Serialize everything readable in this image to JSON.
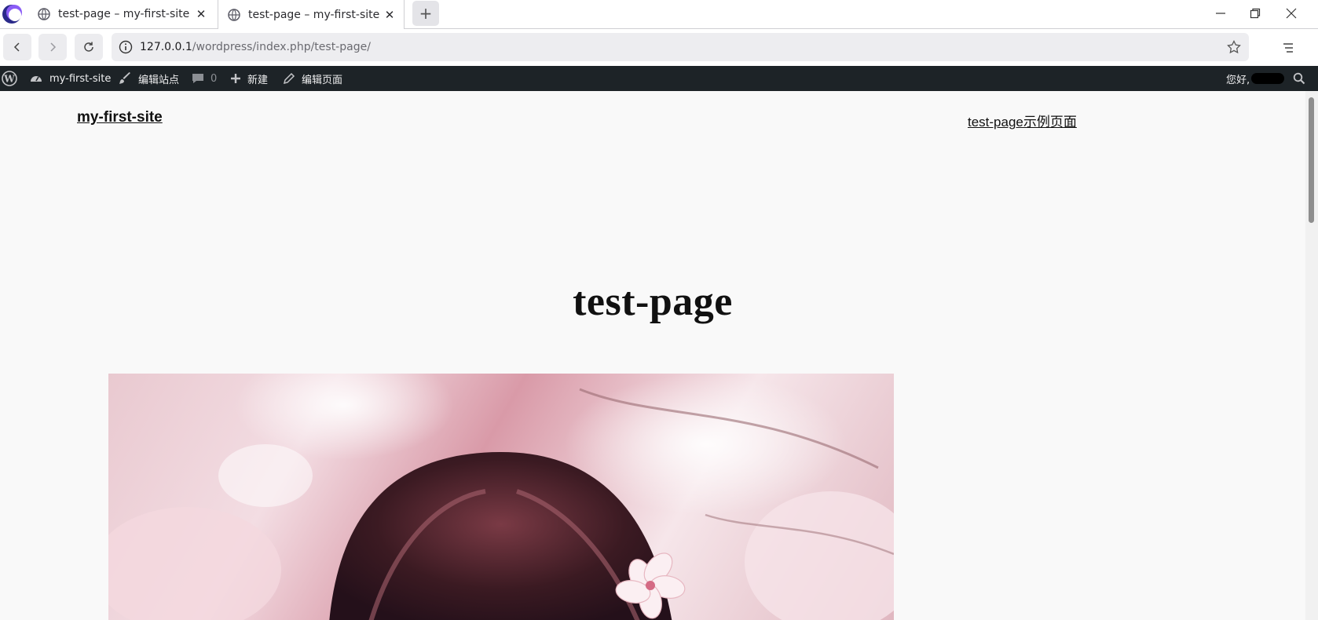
{
  "browser": {
    "tabs": [
      {
        "title": "test-page – my-first-site",
        "close": "✕"
      },
      {
        "title": "test-page – my-first-site",
        "close": "✕"
      }
    ],
    "new_tab": "+",
    "url_host": "127.0.0.1",
    "url_path": "/wordpress/index.php/test-page/"
  },
  "adminbar": {
    "site_name": "my-first-site",
    "customize": "编辑站点",
    "comments_count": "0",
    "new": "新建",
    "edit_page": "编辑页面",
    "greeting": "您好,"
  },
  "page": {
    "site_title": "my-first-site",
    "nav_link": "test-page示例页面",
    "title": "test-page"
  },
  "colors": {
    "adminbar_bg": "#1d2327",
    "page_bg": "#f9f9f9",
    "hero_pink": "#e9c9d0"
  }
}
